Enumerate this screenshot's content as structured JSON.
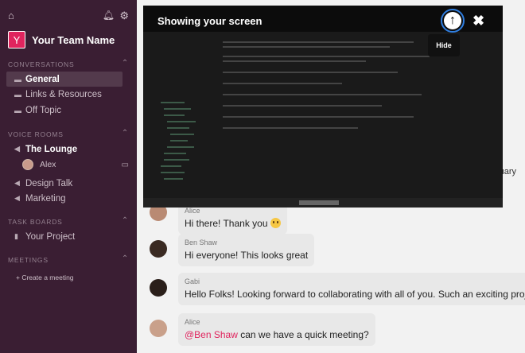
{
  "team": {
    "initial": "Y",
    "name": "Your Team Name"
  },
  "sections": {
    "conversations": "CONVERSATIONS",
    "voice_rooms": "VOICE ROOMS",
    "task_boards": "TASK BOARDS",
    "meetings": "MEETINGS"
  },
  "conversations": [
    {
      "label": "General",
      "active": true
    },
    {
      "label": "Links & Resources",
      "active": false
    },
    {
      "label": "Off Topic",
      "active": false
    }
  ],
  "voice_rooms": [
    {
      "label": "The Lounge",
      "bold": true
    },
    {
      "label": "Design Talk",
      "bold": false
    },
    {
      "label": "Marketing",
      "bold": false
    }
  ],
  "voice_participant": "Alex",
  "task_boards": [
    {
      "label": "Your Project"
    }
  ],
  "meetings": {
    "create": "+ Create a meeting"
  },
  "overlay": {
    "title": "Showing your screen",
    "tooltip": "Hide"
  },
  "messages": [
    {
      "author": "Alice",
      "text": "Hi there! Thank you"
    },
    {
      "author": "Ben Shaw",
      "text": "Hi everyone! This looks great"
    },
    {
      "author": "Gabi",
      "text": "Hello Folks! Looking forward to collaborating with all of you. Such an exciting project t"
    },
    {
      "author": "Alice",
      "mention": "@Ben Shaw",
      "text": "can we have a quick meeting?"
    }
  ],
  "truncated_text": "ruary",
  "colors": {
    "sidebar": "#3a1e33",
    "accent": "#e0245e",
    "hide_ring": "#2f7ee0"
  }
}
